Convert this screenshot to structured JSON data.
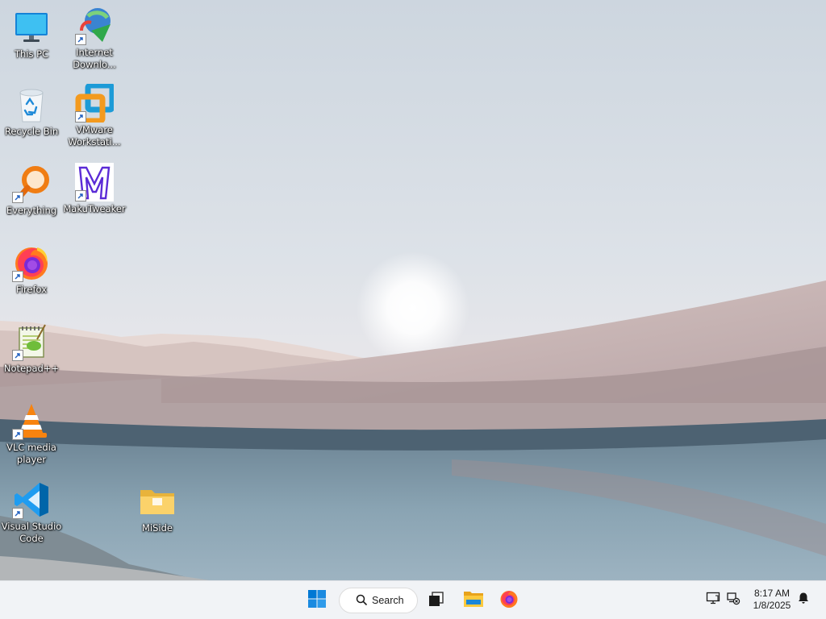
{
  "desktop": {
    "icons": [
      {
        "label": "This PC",
        "icon": "monitor-icon"
      },
      {
        "label": "Internet\nDownlo...",
        "icon": "idm-icon"
      },
      {
        "label": "Recycle Bin",
        "icon": "recycle-bin-icon"
      },
      {
        "label": "VMware\nWorkstati...",
        "icon": "vmware-icon"
      },
      {
        "label": "Everything",
        "icon": "everything-search-icon"
      },
      {
        "label": "MakuTweaker",
        "icon": "makutweaker-icon"
      },
      {
        "label": "Firefox",
        "icon": "firefox-icon"
      },
      {
        "label": "Notepad++",
        "icon": "notepadpp-icon"
      },
      {
        "label": "VLC media\nplayer",
        "icon": "vlc-icon"
      },
      {
        "label": "Visual Studio\nCode",
        "icon": "vscode-icon"
      },
      {
        "label": "MiSide",
        "icon": "folder-icon"
      }
    ]
  },
  "taskbar": {
    "start_icon": "windows-logo-icon",
    "search_label": "Search",
    "pinned": [
      "task-view-icon",
      "file-explorer-icon",
      "firefox-icon"
    ],
    "tray": [
      "display-icon",
      "network-disconnected-icon"
    ],
    "clock": {
      "time": "8:17 AM",
      "date": "1/8/2025"
    },
    "notification_icon": "bell-icon",
    "accent": "#0078d4"
  }
}
